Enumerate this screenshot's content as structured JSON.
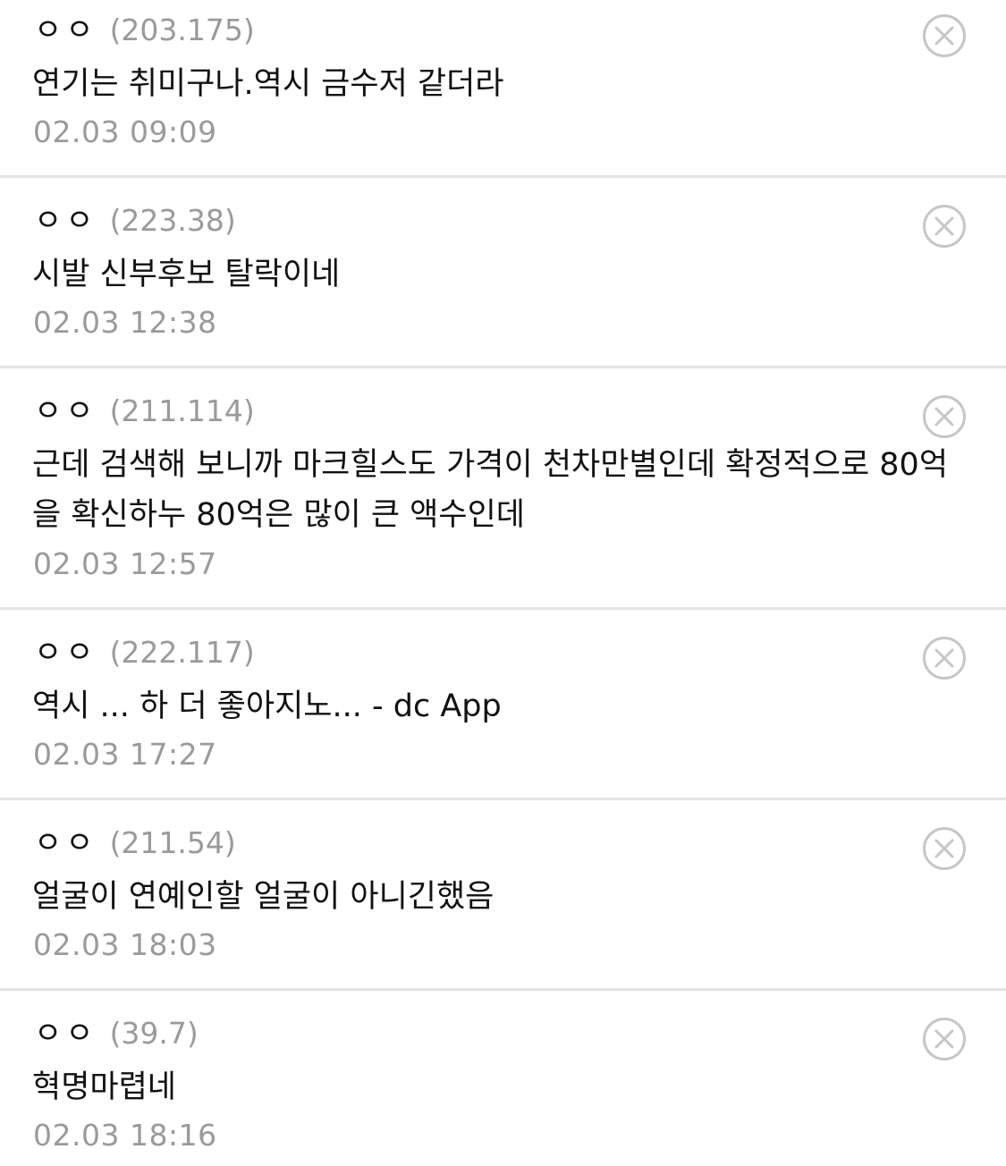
{
  "comments": [
    {
      "nickname": "ㅇㅇ",
      "ip": "(203.175)",
      "text": "연기는 취미구나.역시 금수저 같더라",
      "date": "02.03 09:09"
    },
    {
      "nickname": "ㅇㅇ",
      "ip": "(223.38)",
      "text": "시발 신부후보 탈락이네",
      "date": "02.03 12:38"
    },
    {
      "nickname": "ㅇㅇ",
      "ip": "(211.114)",
      "text": "근데 검색해 보니까 마크힐스도 가격이 천차만별인데 확정적으로 80억을 확신하누 80억은 많이 큰 액수인데",
      "date": "02.03 12:57"
    },
    {
      "nickname": "ㅇㅇ",
      "ip": "(222.117)",
      "text": "역시 ... 하 더 좋아지노... - dc App",
      "date": "02.03 17:27"
    },
    {
      "nickname": "ㅇㅇ",
      "ip": "(211.54)",
      "text": "얼굴이 연예인할 얼굴이 아니긴했음",
      "date": "02.03 18:03"
    },
    {
      "nickname": "ㅇㅇ",
      "ip": "(39.7)",
      "text": "혁명마렵네",
      "date": "02.03 18:16"
    }
  ],
  "icons": {
    "delete": "close-circle-icon"
  },
  "colors": {
    "text": "#111111",
    "meta": "#9a9a9a",
    "icon": "#c6c6c6",
    "divider": "#e3e3e8"
  }
}
